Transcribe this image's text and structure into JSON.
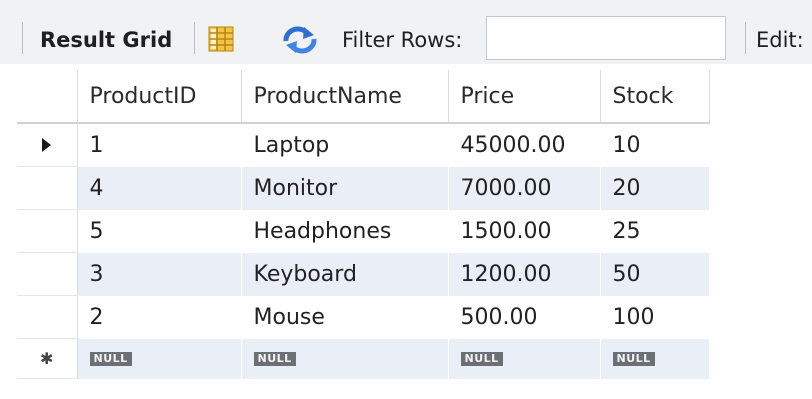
{
  "toolbar": {
    "result_grid_label": "Result Grid",
    "filter_label": "Filter Rows:",
    "filter_value": "",
    "edit_label": "Edit:",
    "grid_icon": "form-grid-icon",
    "refresh_icon": "refresh-icon"
  },
  "table": {
    "columns": [
      "ProductID",
      "ProductName",
      "Price",
      "Stock"
    ],
    "rows": [
      [
        "1",
        "Laptop",
        "45000.00",
        "10"
      ],
      [
        "4",
        "Monitor",
        "7000.00",
        "20"
      ],
      [
        "5",
        "Headphones",
        "1500.00",
        "25"
      ],
      [
        "3",
        "Keyboard",
        "1200.00",
        "50"
      ],
      [
        "2",
        "Mouse",
        "500.00",
        "100"
      ]
    ],
    "null_row": [
      "NULL",
      "NULL",
      "NULL",
      "NULL"
    ],
    "current_row_marker": "▶",
    "new_row_marker": "✱"
  },
  "colors": {
    "toolbar_bg": "#f1f2f4",
    "alt_row_bg": "#e9eef7",
    "null_badge_bg": "#6b7077",
    "refresh_icon_color": "#2f6fd1"
  }
}
